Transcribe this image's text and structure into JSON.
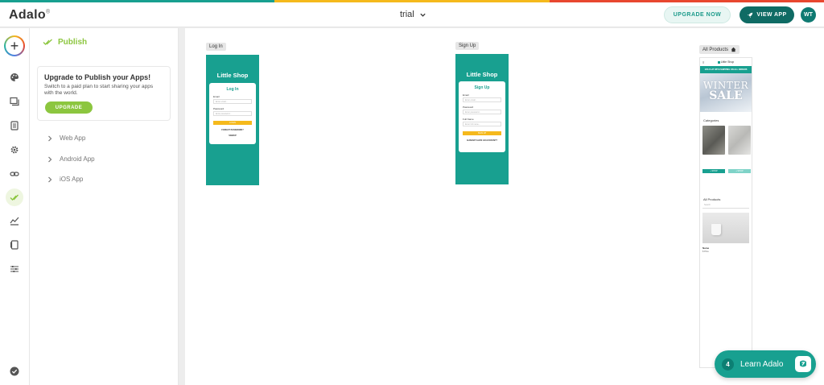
{
  "colors": {
    "brand_teal": "#18a090",
    "dark_teal": "#0f6b64",
    "publish_green": "#8cc63f",
    "yellow": "#f5b91c",
    "strip": [
      "#18a090",
      "#f5b91c",
      "#e8472f"
    ]
  },
  "header": {
    "logo": "Adalo",
    "project_name": "trial",
    "upgrade_now_label": "UPGRADE NOW",
    "view_app_label": "VIEW APP",
    "avatar_initials": "WT"
  },
  "rail": {
    "icons": [
      "add-icon",
      "palette-icon",
      "screens-icon",
      "database-icon",
      "settings-icon",
      "link-icon",
      "publish-icon",
      "analytics-icon",
      "docs-icon",
      "sliders-icon",
      "check-circle-icon"
    ]
  },
  "panel": {
    "title": "Publish",
    "upgrade_card": {
      "heading": "Upgrade to Publish your Apps!",
      "text": "Switch to a paid plan to start sharing your apps with the world.",
      "button": "UPGRADE"
    },
    "items": [
      {
        "label": "Web App"
      },
      {
        "label": "Android App"
      },
      {
        "label": "iOS App"
      }
    ]
  },
  "canvas": {
    "login": {
      "label": "Log In",
      "shop_title": "Little Shop",
      "form_title": "Log In",
      "email_label": "Email",
      "email_placeholder": "Enter email...",
      "password_label": "Password",
      "password_placeholder": "Enter password...",
      "button": "LOGIN",
      "forgot": "FORGOT PASSWORD?",
      "signup_link": "SIGNUP"
    },
    "signup": {
      "label": "Sign Up",
      "shop_title": "Little Shop",
      "form_title": "Sign Up",
      "email_label": "Email",
      "email_placeholder": "Enter email...",
      "password_label": "Password",
      "password_placeholder": "Enter password...",
      "fullname_label": "Full Name",
      "fullname_placeholder": "Enter full name...",
      "button": "SIGN UP",
      "login_link": "ALREADY HAVE AN ACCOUNT?"
    },
    "home": {
      "label": "All Products",
      "shop_title": "Little Shop",
      "banner": "10% FLAT WITH SHIPPING ON ALL ORDERS",
      "winter": "WINTER",
      "sale": "SALE",
      "categories_title": "Categories",
      "cat_buttons": [
        "+ SHOP",
        "+ SHOP"
      ],
      "all_products_title": "All Products",
      "search_placeholder": "Search",
      "product_name": "Name",
      "product_price": "$ Price"
    }
  },
  "learn": {
    "count": "4",
    "label": "Learn Adalo"
  }
}
